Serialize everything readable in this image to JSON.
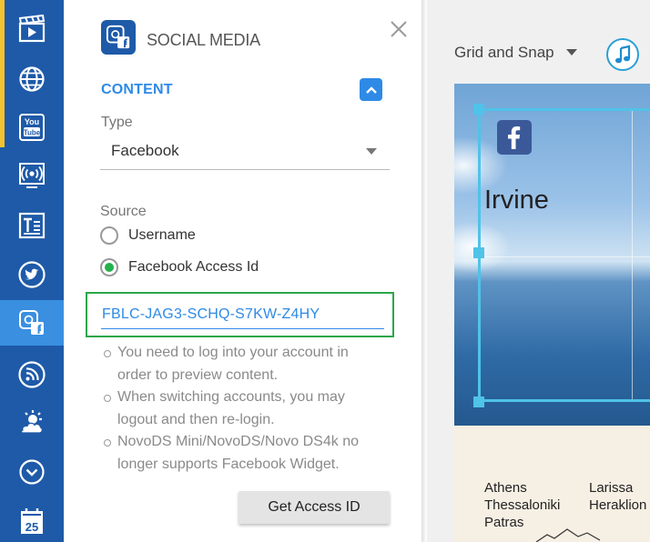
{
  "sidebar": {
    "items": [
      {
        "name": "video-clapper-icon"
      },
      {
        "name": "globe-icon"
      },
      {
        "name": "youtube-icon",
        "text_top": "You",
        "text_bottom": "Tube"
      },
      {
        "name": "live-stream-icon"
      },
      {
        "name": "text-icon"
      },
      {
        "name": "twitter-icon"
      },
      {
        "name": "social-media-icon",
        "active": true
      },
      {
        "name": "rss-icon"
      },
      {
        "name": "weather-icon"
      },
      {
        "name": "clock-icon"
      },
      {
        "name": "calendar-icon",
        "text": "25"
      }
    ],
    "colors": {
      "background": "#1e5aa8",
      "active": "#3a8fe0",
      "accent": "#f2c230"
    }
  },
  "panel": {
    "title": "SOCIAL MEDIA",
    "section_title": "CONTENT",
    "type": {
      "label": "Type",
      "selected": "Facebook"
    },
    "source": {
      "label": "Source",
      "options": [
        {
          "label": "Username",
          "checked": false
        },
        {
          "label": "Facebook Access Id",
          "checked": true
        }
      ]
    },
    "access_id_value": "FBLC-JAG3-SCHQ-S7KW-Z4HY",
    "notes": [
      "You need to log into your account in order to preview content.",
      "When switching accounts, you may logout and then re-login.",
      "NovoDS Mini/NovoDS/Novo DS4k no longer supports Facebook Widget."
    ],
    "button_label": "Get Access ID",
    "colors": {
      "accent": "#2e8ae6",
      "radio_checked": "#22b14c",
      "focus_border": "#2aa64a"
    }
  },
  "workspace": {
    "grid_snap_label": "Grid and Snap",
    "preview": {
      "city_main": "Irvine",
      "cities_col1": [
        "Athens",
        "Thessaloniki",
        "Patras"
      ],
      "cities_col2": [
        "Larissa",
        "Heraklion"
      ]
    },
    "colors": {
      "selection": "#4fc3e8",
      "facebook": "#3b5998"
    }
  }
}
